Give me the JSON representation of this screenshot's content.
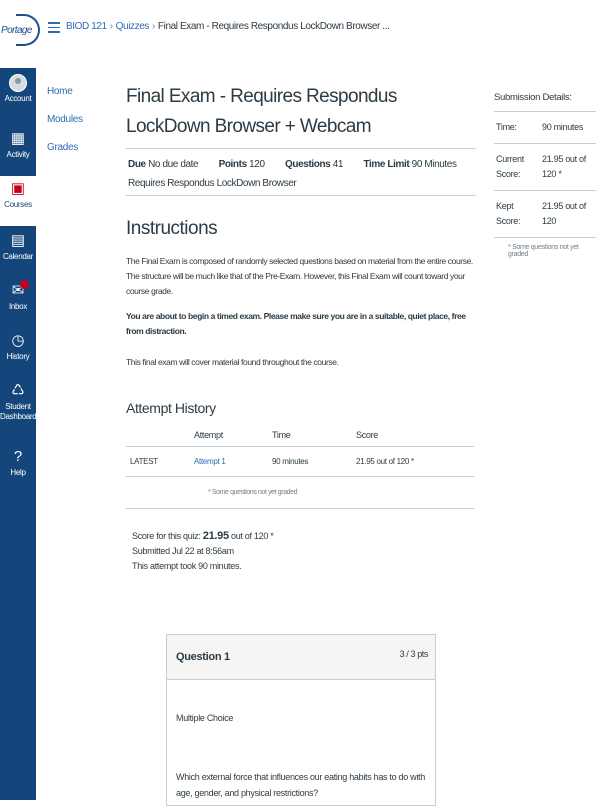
{
  "logo": {
    "text": "Portage"
  },
  "global_nav": {
    "items": [
      {
        "label": "Account"
      },
      {
        "label": "Activity"
      },
      {
        "label": "Courses"
      },
      {
        "label": "Calendar"
      },
      {
        "label": "Inbox"
      },
      {
        "label": "History"
      },
      {
        "label": "Student Dashboard"
      },
      {
        "label": "Help"
      }
    ]
  },
  "breadcrumb": {
    "course": "BIOD 121",
    "section": "Quizzes",
    "current": "Final Exam - Requires Respondus LockDown Browser ..."
  },
  "course_nav": [
    "Home",
    "Modules",
    "Grades"
  ],
  "quiz": {
    "title": "Final Exam - Requires Respondus LockDown Browser + Webcam",
    "due_label": "Due",
    "due_value": "No due date",
    "points_label": "Points",
    "points_value": "120",
    "questions_label": "Questions",
    "questions_value": "41",
    "time_limit_label": "Time Limit",
    "time_limit_value": "90 Minutes",
    "requirement": "Requires Respondus LockDown Browser"
  },
  "instructions": {
    "heading": "Instructions",
    "p1": "The Final Exam is composed of randomly selected questions based on material from the entire course. The structure will be much like that of the Pre-Exam. However, this Final Exam will count toward your course grade.",
    "p2": "You are about to begin a timed exam. Please make sure you are in a suitable, quiet place, free from distraction.",
    "p3": "This final exam will cover material found throughout the course."
  },
  "attempt_history": {
    "heading": "Attempt History",
    "columns": [
      "",
      "Attempt",
      "Time",
      "Score"
    ],
    "rows": [
      {
        "tag": "LATEST",
        "attempt": "Attempt 1",
        "time": "90 minutes",
        "score": "21.95 out of 120 *"
      }
    ],
    "note": "* Some questions not yet graded"
  },
  "score_summary": {
    "score_prefix": "Score for this quiz:",
    "score_value": "21.95",
    "score_suffix": "out of 120 *",
    "submitted": "Submitted Jul 22 at 8:56am",
    "duration": "This attempt took 90 minutes."
  },
  "question": {
    "title": "Question 1",
    "points": "3 / 3 pts",
    "type": "Multiple Choice",
    "text": "Which external force that influences our eating habits has to do with age, gender, and physical restrictions?"
  },
  "submission_details": {
    "heading": "Submission Details:",
    "rows": [
      {
        "key": "Time:",
        "value": "90 minutes"
      },
      {
        "key": "Current Score:",
        "value": "21.95 out of 120 *"
      },
      {
        "key": "Kept Score:",
        "value": "21.95 out of 120"
      }
    ],
    "note": "* Some questions not yet graded"
  },
  "colors": {
    "nav_bg": "#14467c",
    "link": "#2d6db5",
    "text": "#2d3b45"
  }
}
